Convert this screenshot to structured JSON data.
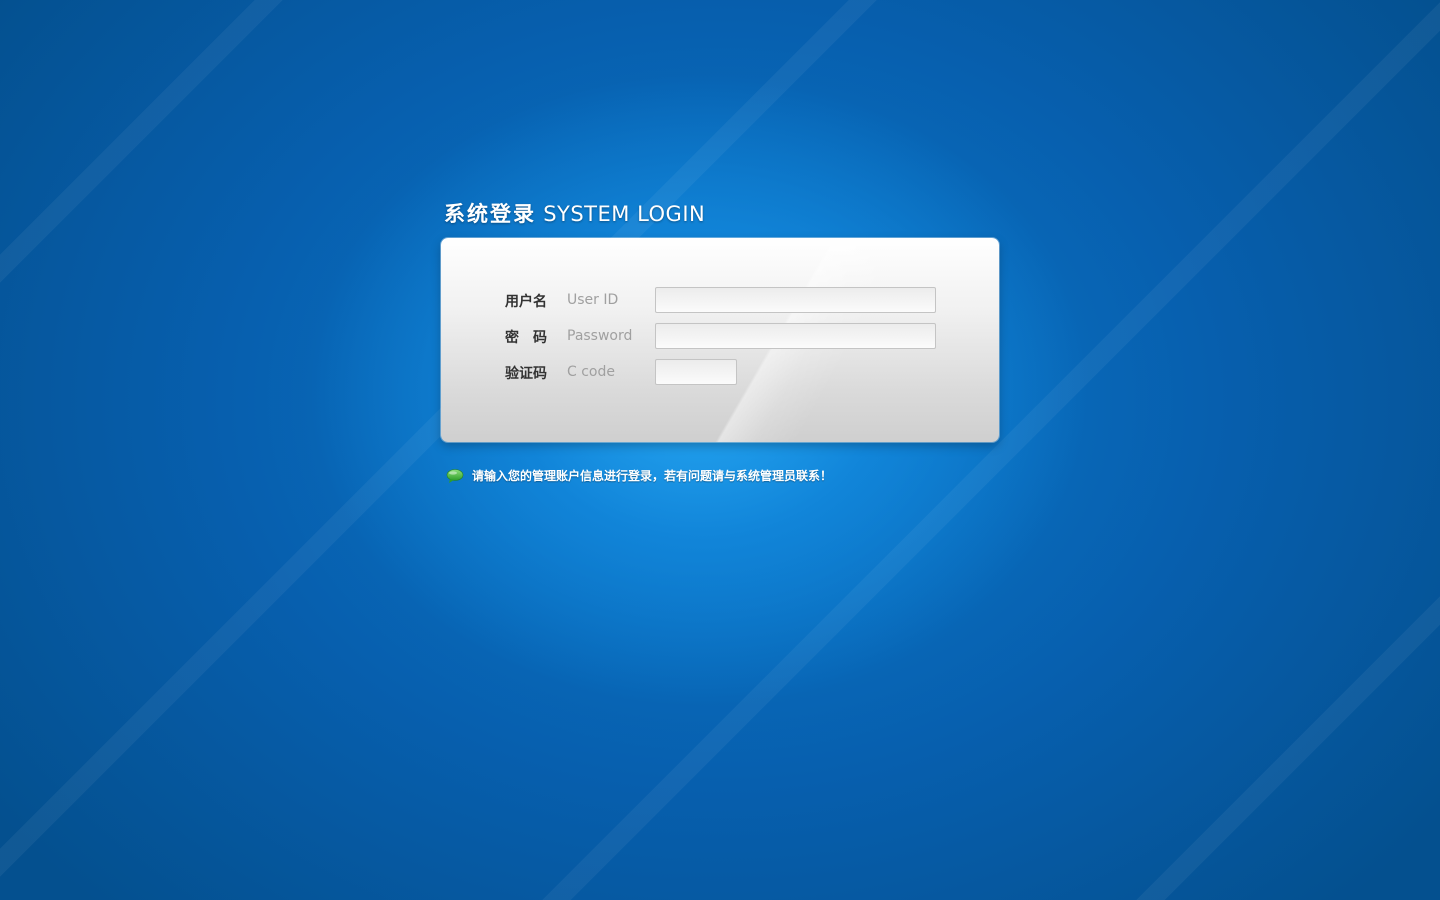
{
  "header": {
    "title_cn": "系统登录",
    "title_en": "SYSTEM LOGIN"
  },
  "form": {
    "username": {
      "label_cn": "用户名",
      "label_en": "User ID",
      "value": ""
    },
    "password": {
      "label_cn": "密　码",
      "label_en": "Password",
      "value": ""
    },
    "captcha": {
      "label_cn": "验证码",
      "label_en": "C code",
      "value": ""
    }
  },
  "notice": {
    "icon": "chat-bubble-icon",
    "text": "请输入您的管理账户信息进行登录，若有问题请与系统管理员联系！"
  },
  "colors": {
    "background": "#075fae",
    "glow": "#1e9ae8",
    "panel": "#f1f1f1",
    "label": "#333333",
    "hint": "#a0a0a0",
    "notice_icon": "#3fb83a"
  }
}
